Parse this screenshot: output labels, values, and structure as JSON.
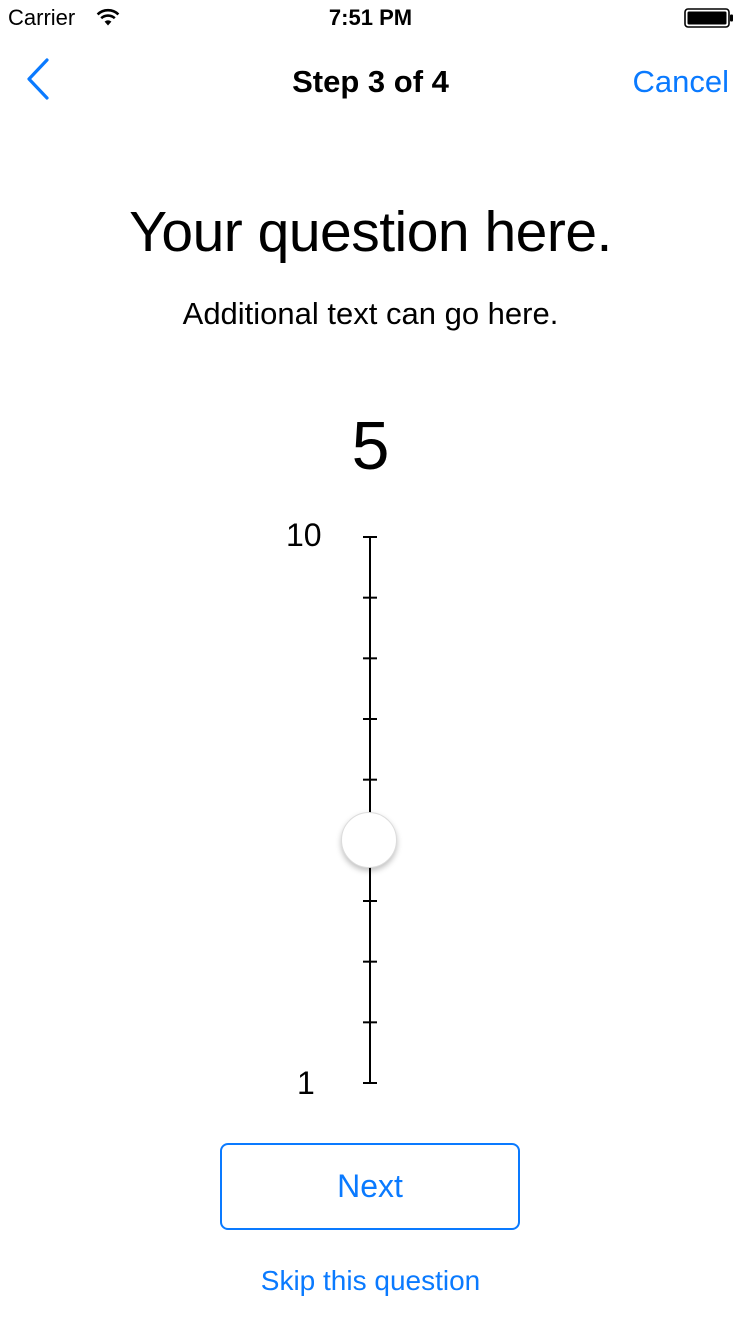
{
  "status_bar": {
    "carrier": "Carrier",
    "time": "7:51 PM",
    "wifi_icon": "wifi-icon",
    "battery_icon": "battery-full-icon"
  },
  "nav": {
    "back_icon": "chevron-left-icon",
    "title": "Step 3 of 4",
    "cancel_label": "Cancel"
  },
  "question": {
    "title": "Your question here.",
    "detail": "Additional text can go here."
  },
  "scale": {
    "current_value": "5",
    "min_label": "1",
    "max_label": "10",
    "min": 1,
    "max": 10,
    "value": 5,
    "orientation": "vertical"
  },
  "actions": {
    "next_label": "Next",
    "skip_label": "Skip this question"
  },
  "colors": {
    "accent": "#0a7aff",
    "text": "#000000",
    "background": "#ffffff"
  }
}
